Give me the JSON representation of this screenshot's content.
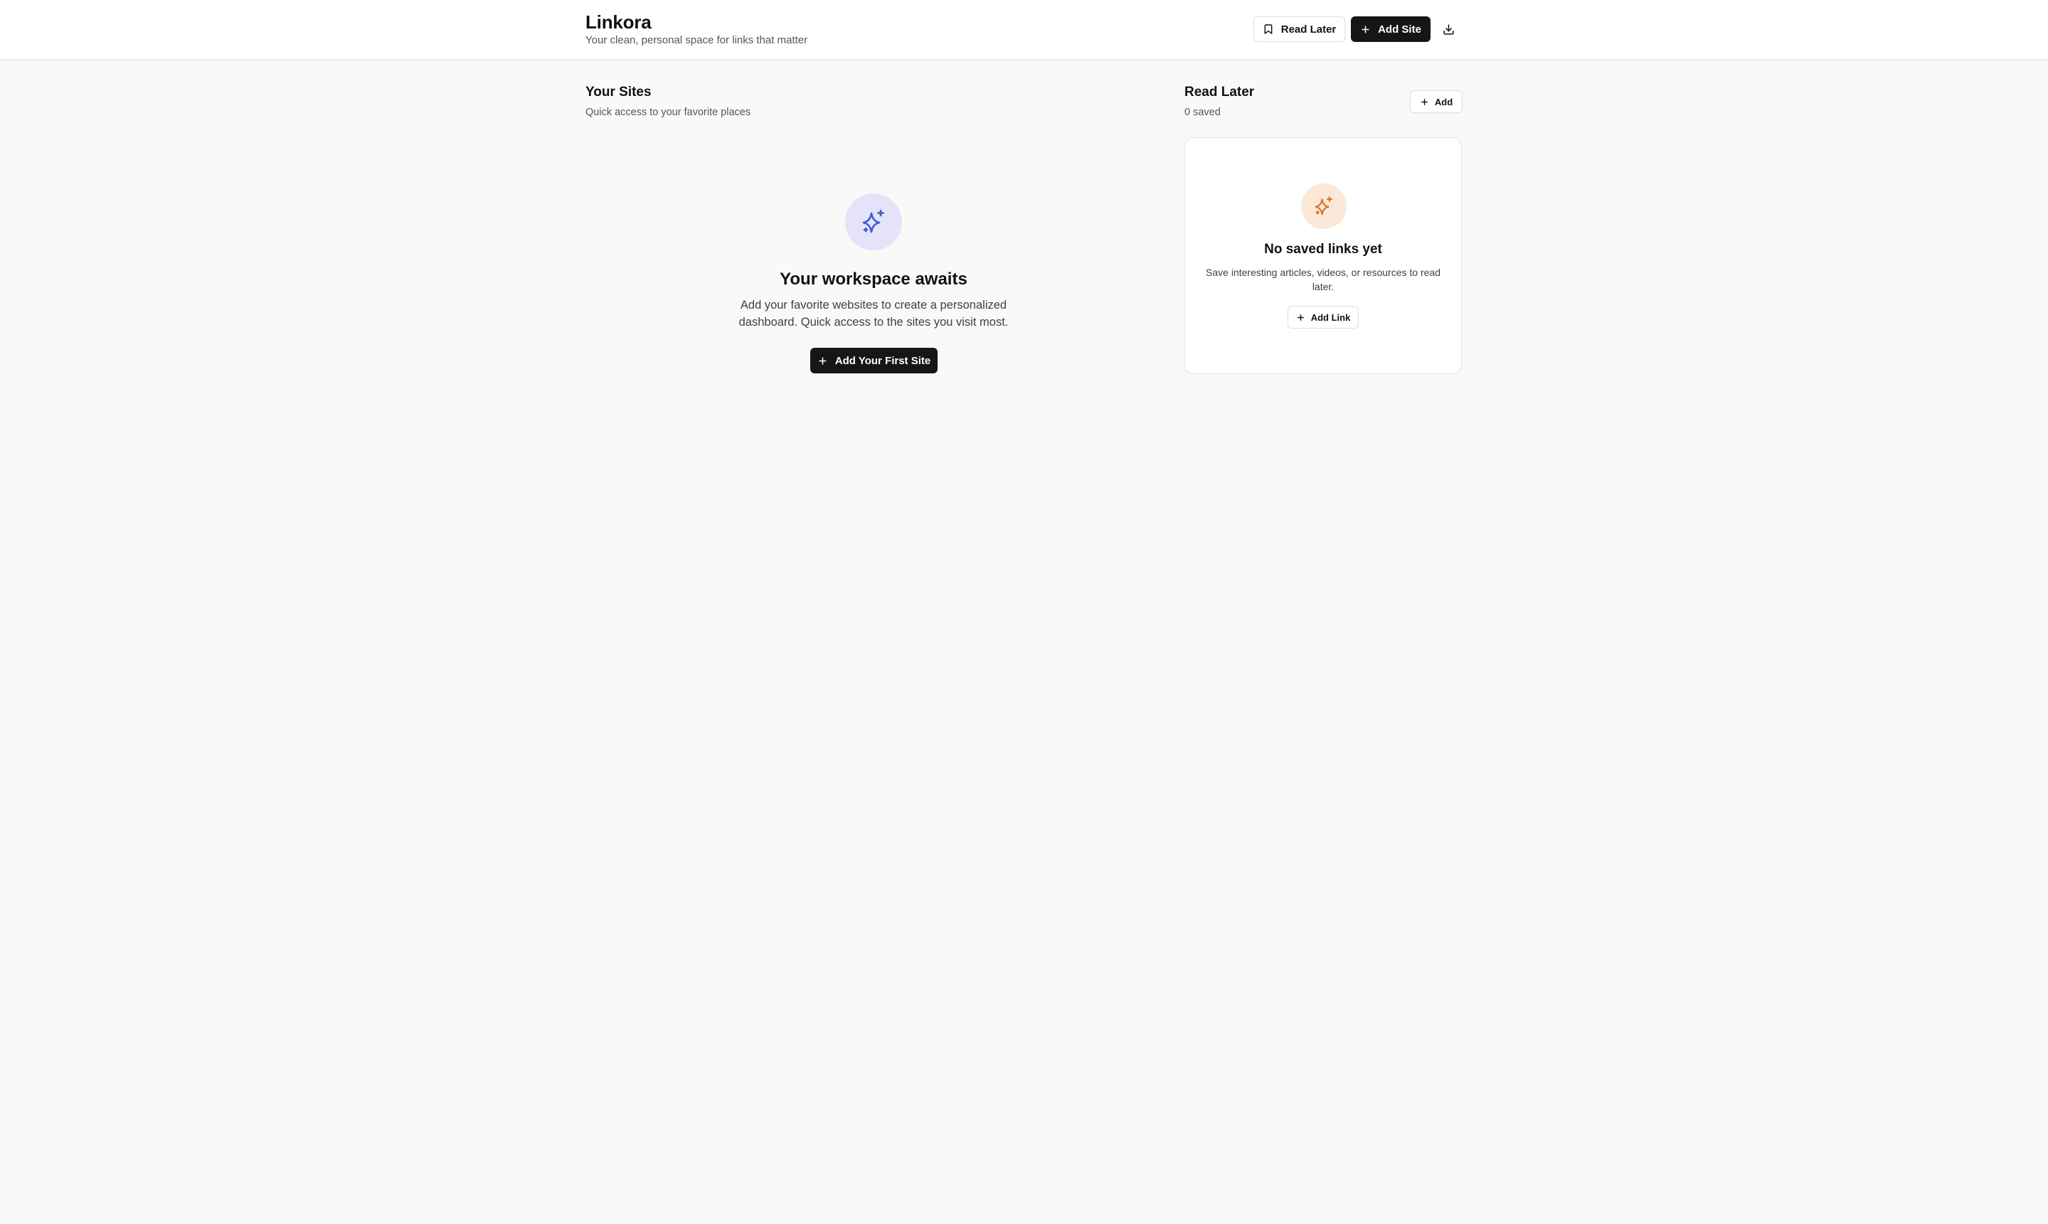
{
  "header": {
    "title": "Linkora",
    "tagline": "Your clean, personal space for links that matter",
    "read_later_label": "Read Later",
    "add_site_label": "Add Site",
    "icons": {
      "read_later": "bookmark-icon",
      "add_site": "plus-icon",
      "download": "download-icon"
    }
  },
  "sites": {
    "title": "Your Sites",
    "subtitle": "Quick access to your favorite places",
    "empty": {
      "icon": "sparkles-icon",
      "icon_color": "#3b5bd6",
      "icon_bg": "#e5e3fa",
      "heading": "Your workspace awaits",
      "text": "Add your favorite websites to create a personalized dashboard. Quick access to the sites you visit most.",
      "button_label": "Add Your First Site"
    }
  },
  "read_later": {
    "title": "Read Later",
    "count_text": "0 saved",
    "add_label": "Add",
    "empty": {
      "icon": "sparkles-icon",
      "icon_color": "#d9742a",
      "icon_bg": "#fbe8d6",
      "heading": "No saved links yet",
      "text": "Save interesting articles, videos, or resources to read later.",
      "button_label": "Add Link"
    }
  },
  "colors": {
    "background": "#f9f9f8",
    "surface": "#ffffff",
    "primary_button": "#161616",
    "text": "#111111",
    "muted_text": "#55565a",
    "border": "#dedede"
  }
}
